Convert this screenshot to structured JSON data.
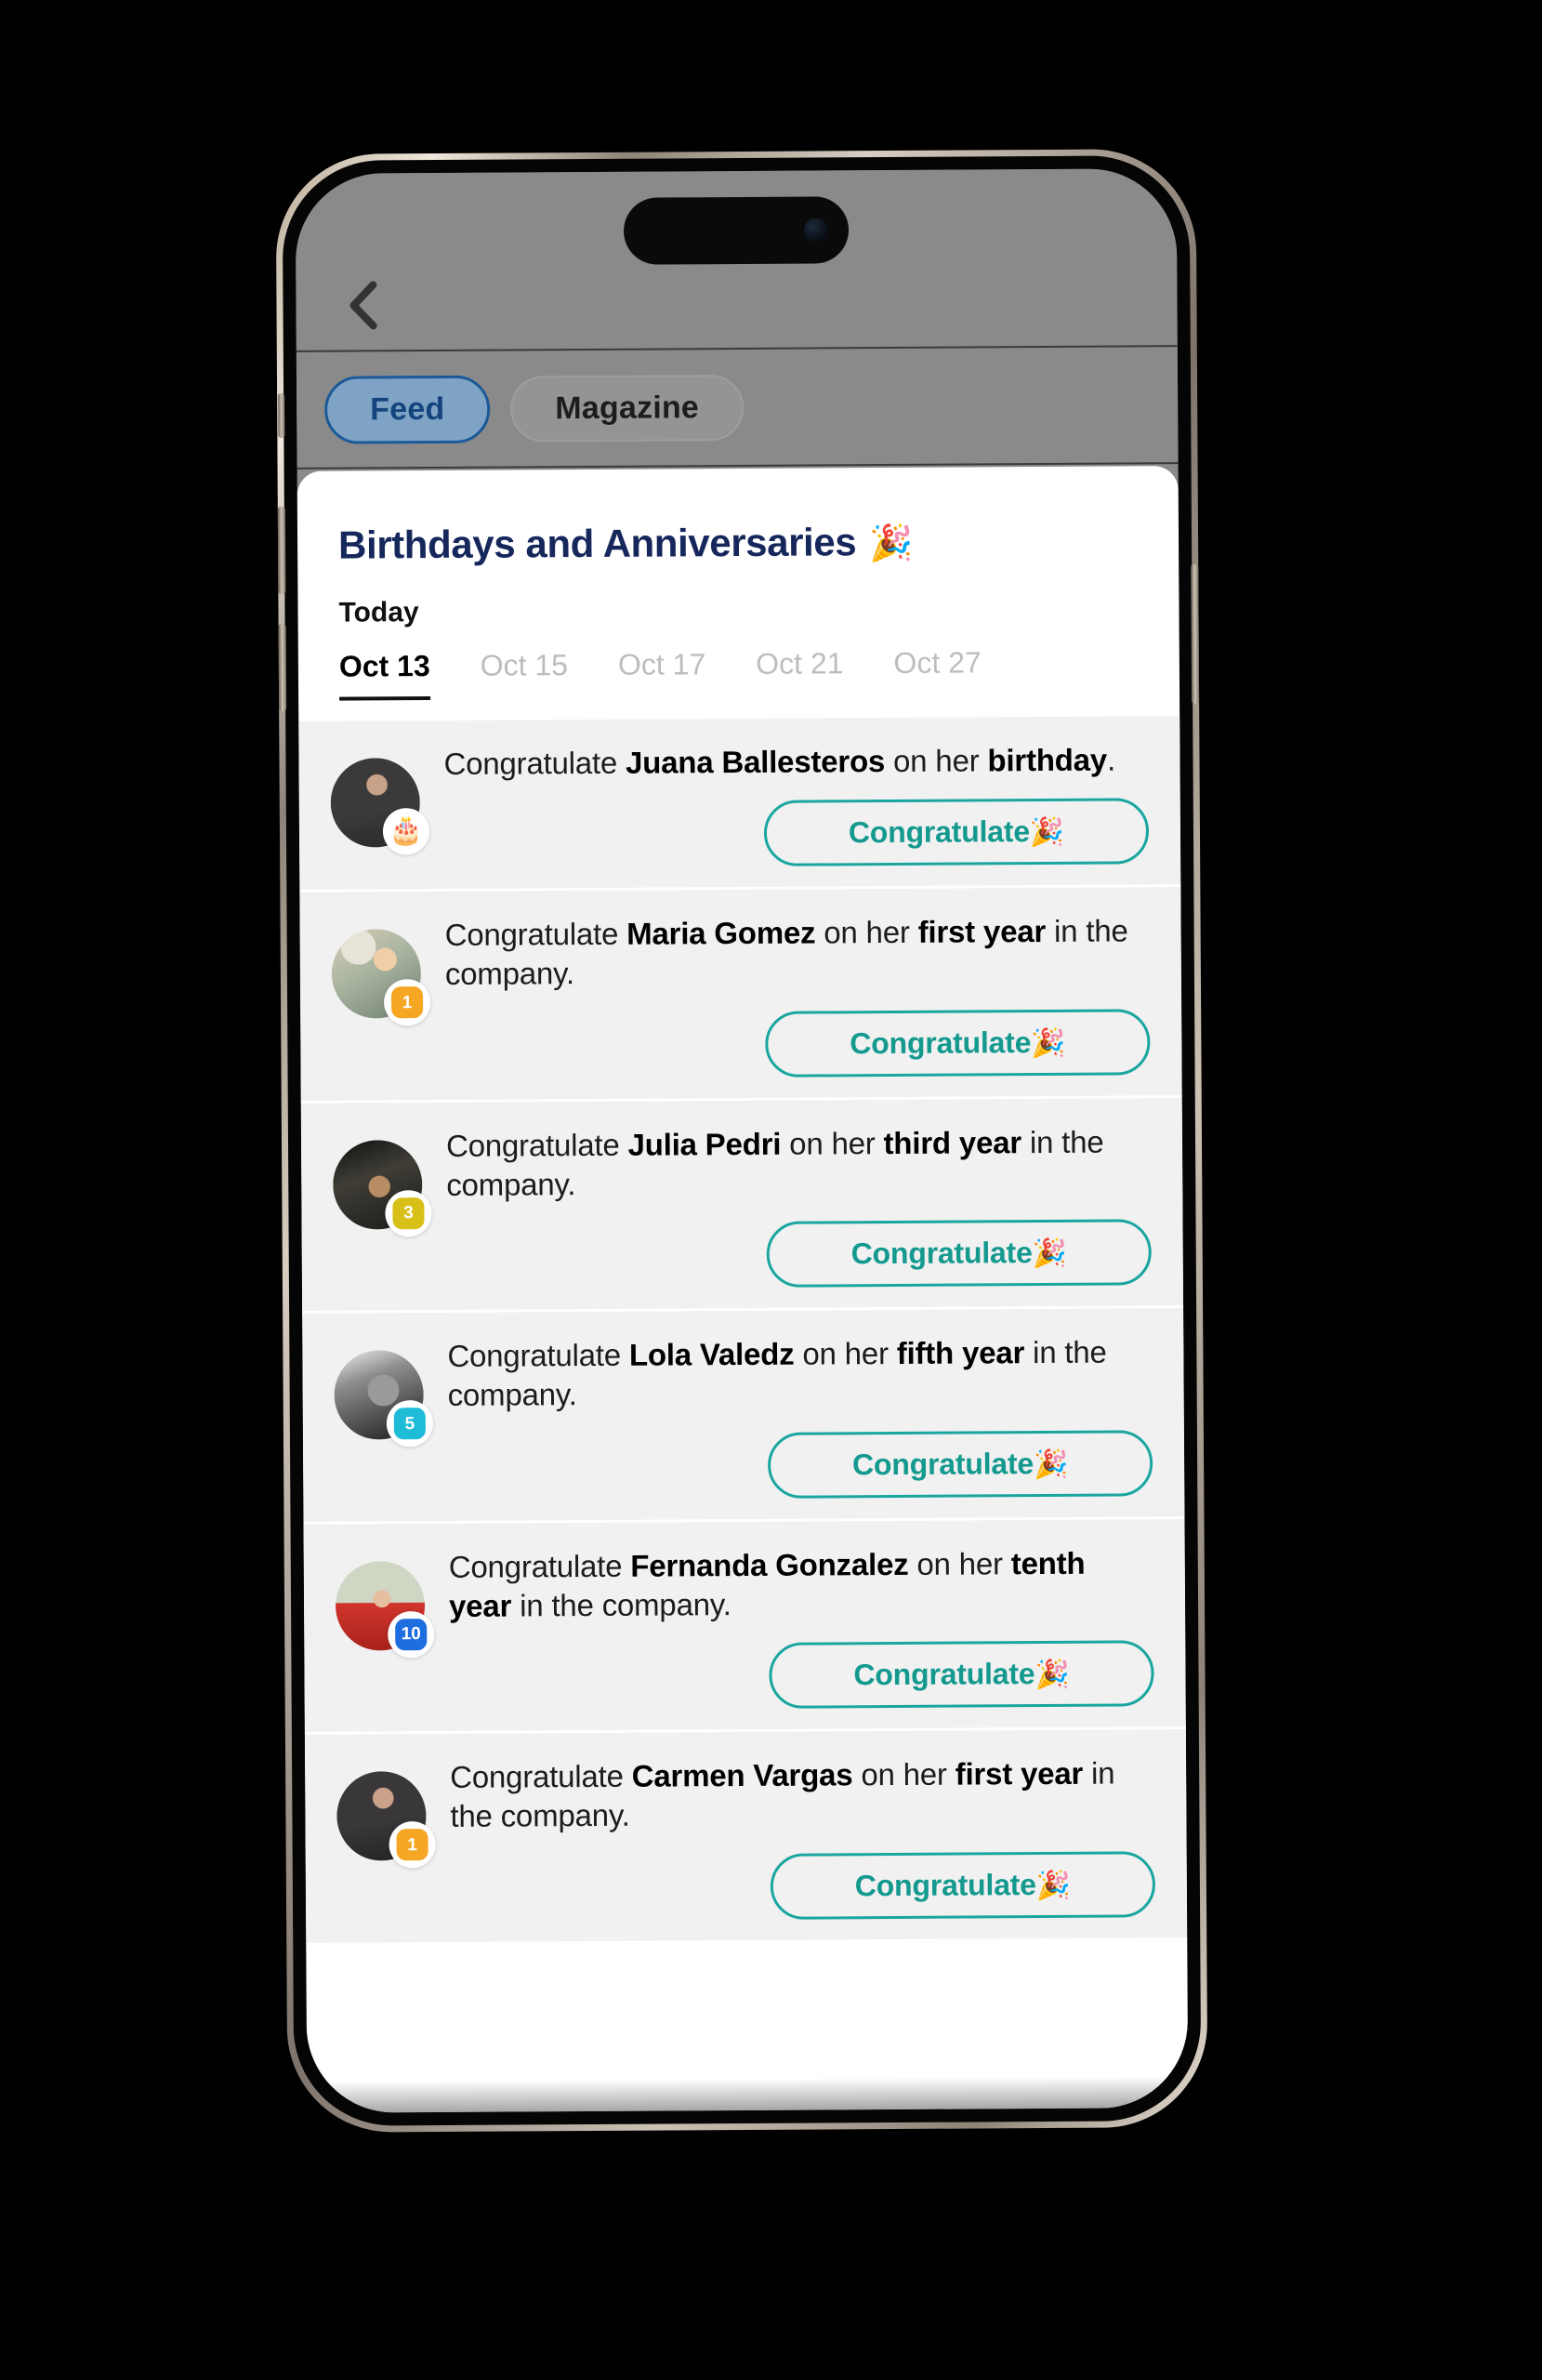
{
  "device": {
    "name": "iphone-mockup"
  },
  "topbar": {
    "back_icon": "chevron-left-icon"
  },
  "segmented": {
    "tabs": [
      {
        "label": "Feed",
        "active": true
      },
      {
        "label": "Magazine",
        "active": false
      }
    ]
  },
  "card": {
    "title": "Birthdays and Anniversaries",
    "title_emoji": "🎉",
    "today_label": "Today",
    "date_tabs": [
      {
        "label": "Oct 13",
        "active": true
      },
      {
        "label": "Oct 15",
        "active": false
      },
      {
        "label": "Oct 17",
        "active": false
      },
      {
        "label": "Oct 21",
        "active": false
      },
      {
        "label": "Oct 27",
        "active": false
      }
    ]
  },
  "button": {
    "label": "Congratulate",
    "emoji": "🎉",
    "color": "#14998f",
    "border_color": "#1aa6a0"
  },
  "feed": [
    {
      "prefix": "Congratulate ",
      "name": "Juana Ballesteros",
      "middle": " on her ",
      "highlight": "birthday",
      "suffix": ".",
      "badge_type": "cake",
      "badge_emoji": "🎂",
      "badge_value": "",
      "badge_color": "#f7c8d6",
      "avatar_class": "av-a",
      "button_label": "Congratulate",
      "button_emoji": "🎉"
    },
    {
      "prefix": "Congratulate ",
      "name": "Maria Gomez",
      "middle": " on her ",
      "highlight": "first year",
      "suffix": " in the company.",
      "badge_type": "years",
      "badge_emoji": "",
      "badge_value": "1",
      "badge_color": "#f5a623",
      "avatar_class": "av-b",
      "button_label": "Congratulate",
      "button_emoji": "🎉"
    },
    {
      "prefix": "Congratulate ",
      "name": "Julia Pedri",
      "middle": " on her ",
      "highlight": "third year",
      "suffix": " in the company.",
      "badge_type": "years",
      "badge_emoji": "",
      "badge_value": "3",
      "badge_color": "#d8c018",
      "avatar_class": "av-c",
      "button_label": "Congratulate",
      "button_emoji": "🎉"
    },
    {
      "prefix": "Congratulate ",
      "name": "Lola Valedz",
      "middle": " on her ",
      "highlight": "fifth year",
      "suffix": " in the company.",
      "badge_type": "years",
      "badge_emoji": "",
      "badge_value": "5",
      "badge_color": "#1fbcd8",
      "avatar_class": "av-d",
      "button_label": "Congratulate",
      "button_emoji": "🎉"
    },
    {
      "prefix": "Congratulate ",
      "name": "Fernanda Gonzalez",
      "middle": " on her ",
      "highlight": "tenth year",
      "suffix": " in the company.",
      "badge_type": "years",
      "badge_emoji": "",
      "badge_value": "10",
      "badge_color": "#1f6ee0",
      "avatar_class": "av-e",
      "button_label": "Congratulate",
      "button_emoji": "🎉"
    },
    {
      "prefix": "Congratulate ",
      "name": "Carmen Vargas",
      "middle": " on her ",
      "highlight": "first year",
      "suffix": " in the company.",
      "badge_type": "years",
      "badge_emoji": "",
      "badge_value": "1",
      "badge_color": "#f5a623",
      "avatar_class": "av-f",
      "button_label": "Congratulate",
      "button_emoji": "🎉"
    }
  ]
}
